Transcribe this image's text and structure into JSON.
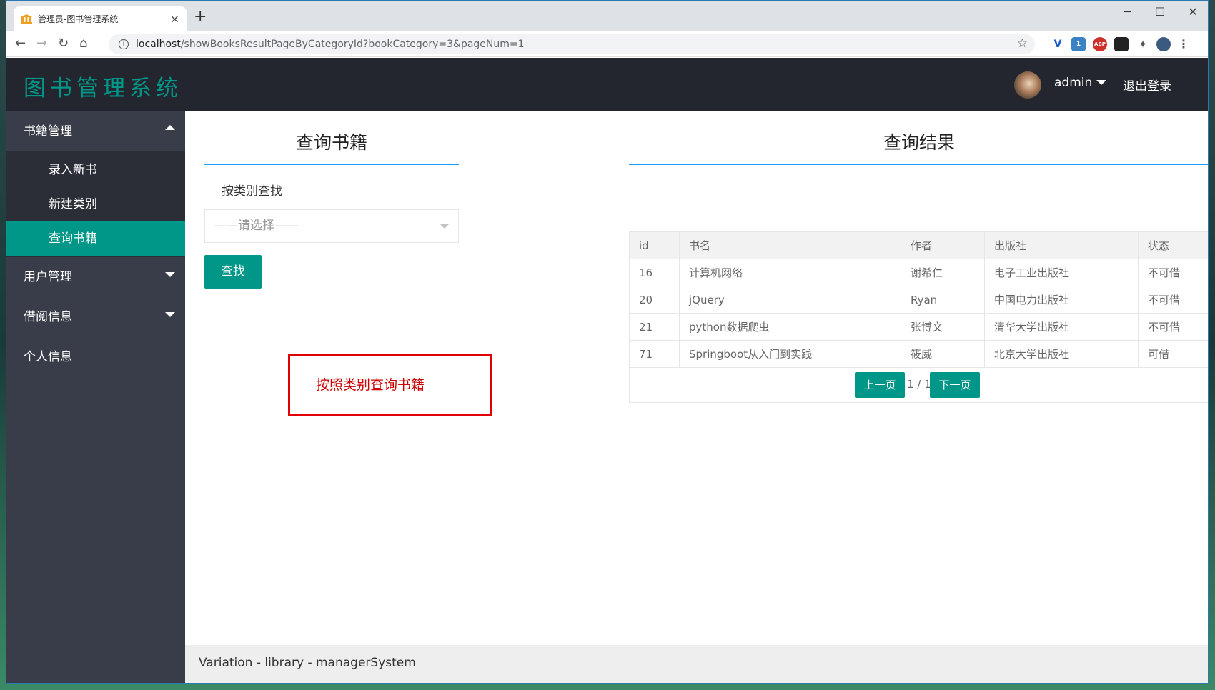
{
  "browser": {
    "tab_title": "管理员-图书管理系统",
    "tab_close": "×",
    "new_tab": "+",
    "url_host": "localhost",
    "url_rest": "/showBooksResultPageByCategoryId?bookCategory=3&pageNum=1",
    "ext_badge": "1",
    "ext_abp": "ABP"
  },
  "header": {
    "logo": "图书管理系统",
    "username": "admin",
    "logout": "退出登录"
  },
  "sidebar": {
    "items": [
      {
        "label": "书籍管理",
        "expanded": true,
        "children": [
          "录入新书",
          "新建类别",
          "查询书籍"
        ],
        "active_child": "查询书籍"
      },
      {
        "label": "用户管理",
        "expanded": false
      },
      {
        "label": "借阅信息",
        "expanded": false
      },
      {
        "label": "个人信息"
      }
    ]
  },
  "query_panel": {
    "title": "查询书籍",
    "label": "按类别查找",
    "select_placeholder": "——请选择——",
    "search_button": "查找",
    "annotation": "按照类别查询书籍"
  },
  "result_panel": {
    "title": "查询结果",
    "columns": [
      "id",
      "书名",
      "作者",
      "出版社",
      "状态"
    ],
    "rows": [
      [
        "16",
        "计算机网络",
        "谢希仁",
        "电子工业出版社",
        "不可借"
      ],
      [
        "20",
        "jQuery",
        "Ryan",
        "中国电力出版社",
        "不可借"
      ],
      [
        "21",
        "python数据爬虫",
        "张博文",
        "清华大学出版社",
        "不可借"
      ],
      [
        "71",
        "Springboot从入门到实践",
        "筱威",
        "北京大学出版社",
        "可借"
      ]
    ],
    "pager": {
      "prev": "上一页",
      "info": "1 / 1",
      "next": "下一页"
    }
  },
  "footer": "Variation - library - managerSystem",
  "colors": {
    "accent": "#009688",
    "header_bg": "#23262e",
    "sidebar_bg": "#393d49",
    "annotation": "#e00000"
  }
}
